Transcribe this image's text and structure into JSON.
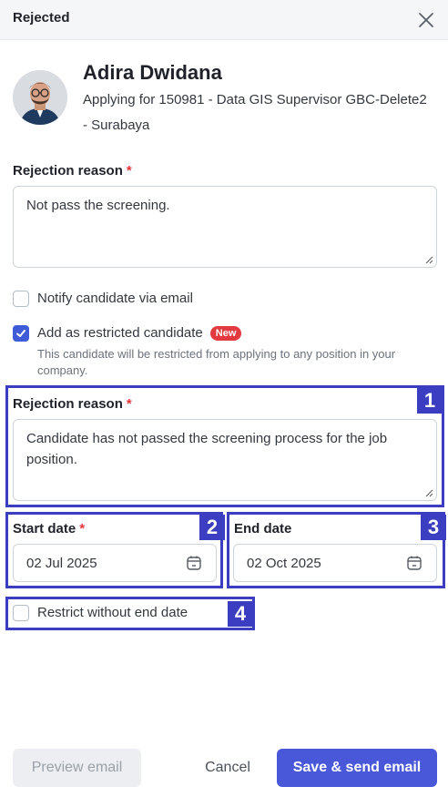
{
  "dialog": {
    "title": "Rejected"
  },
  "candidate": {
    "name": "Adira Dwidana",
    "applying": "Applying for 150981 - Data GIS Supervisor GBC-Delete2 - Surabaya"
  },
  "rejection": {
    "label": "Rejection reason",
    "required_mark": "*",
    "value": "Not pass the screening."
  },
  "notify": {
    "label": "Notify candidate via email",
    "checked": false
  },
  "restricted": {
    "label": "Add as restricted candidate",
    "badge": "New",
    "hint": "This candidate will be restricted from applying to any position in your company.",
    "checked": true
  },
  "restriction": {
    "reason_label": "Rejection reason",
    "required_mark": "*",
    "reason_value": "Candidate has not passed the screening process for the job position.",
    "start_label": "Start date",
    "start_value": "02 Jul 2025",
    "end_label": "End date",
    "end_value": "02 Oct 2025",
    "no_end_label": "Restrict without end date",
    "no_end_checked": false
  },
  "annotations": [
    "1",
    "2",
    "3",
    "4"
  ],
  "footer": {
    "preview": "Preview email",
    "cancel": "Cancel",
    "save": "Save & send email"
  },
  "colors": {
    "accent": "#4957d9",
    "highlight": "#3b3ec1",
    "required": "#e5363a",
    "badge": "#e23a3e"
  }
}
